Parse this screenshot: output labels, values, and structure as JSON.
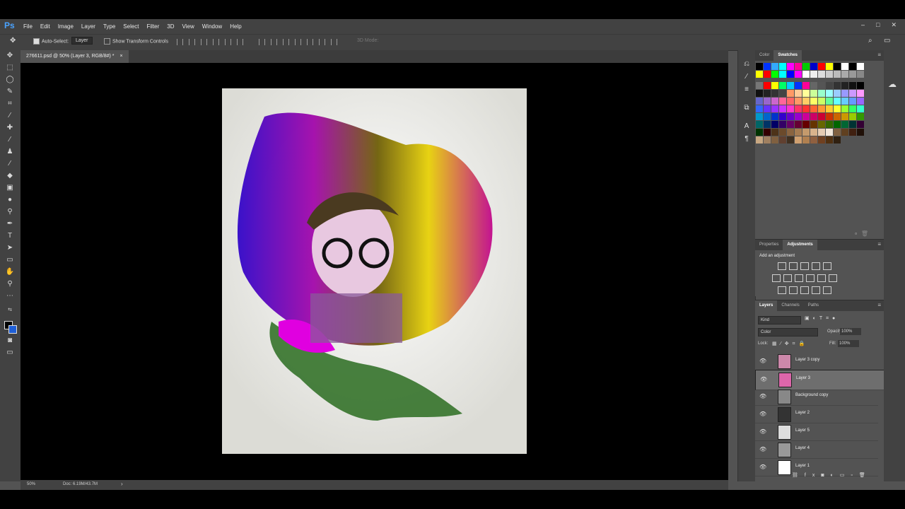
{
  "app": {
    "logo": "Ps"
  },
  "menu": [
    "File",
    "Edit",
    "Image",
    "Layer",
    "Type",
    "Select",
    "Filter",
    "3D",
    "View",
    "Window",
    "Help"
  ],
  "window_controls": [
    "–",
    "□",
    "✕"
  ],
  "options": {
    "auto_select_label": "Auto-Select:",
    "auto_select_value": "Layer",
    "show_transform_label": "Show Transform Controls",
    "mode_3d_label": "3D Mode:"
  },
  "document": {
    "tab_title": "276611.psd @ 50% (Layer 3, RGB/8#) *",
    "close": "×"
  },
  "status": {
    "zoom": "50%",
    "doc": "Doc: 6.19M/43.7M",
    "arrow": "›"
  },
  "panels": {
    "color_tab": "Color",
    "swatches_tab": "Swatches",
    "properties_tab": "Properties",
    "adjustments_tab": "Adjustments",
    "add_adjustment": "Add an adjustment",
    "layers_tab": "Layers",
    "channels_tab": "Channels",
    "paths_tab": "Paths"
  },
  "layers_panel": {
    "kind": "Kind",
    "blend_mode": "Color",
    "opacity_label": "Opacity:",
    "opacity_value": "100%",
    "lock_label": "Lock:",
    "fill_label": "Fill:",
    "fill_value": "100%",
    "layers": [
      {
        "name": "Layer 3 copy",
        "selected": false,
        "thumb": "#c8a"
      },
      {
        "name": "Layer 3",
        "selected": true,
        "thumb": "#d6a"
      },
      {
        "name": "Background copy",
        "selected": false,
        "thumb": "#888"
      },
      {
        "name": "Layer 2",
        "selected": false,
        "thumb": "#333"
      },
      {
        "name": "Layer 5",
        "selected": false,
        "thumb": "#ddd"
      },
      {
        "name": "Layer 4",
        "selected": false,
        "thumb": "#999"
      },
      {
        "name": "Layer 1",
        "selected": false,
        "thumb": "#fff"
      }
    ]
  },
  "colors": {
    "swatch_rows": [
      [
        "#000000",
        "#0033ff",
        "#33aaff",
        "#00ffff",
        "#ff00ff",
        "#ff0099",
        "#00cc00",
        "#0000cc",
        "#ff0000",
        "#ffff00",
        "#000000",
        "#ffffff",
        "#000000",
        "#ffffff"
      ],
      [
        "#ffff00",
        "#ff0000",
        "#00ff00",
        "#00ffff",
        "#0000ff",
        "#ff00ff",
        "#ffffff",
        "#eeeeee",
        "#dddddd",
        "#cccccc",
        "#bbbbbb",
        "#aaaaaa",
        "#999999",
        "#888888"
      ],
      [
        "#777777",
        "#ff0000",
        "#ffff00",
        "#00ff66",
        "#00ccff",
        "#0033ff",
        "#ff0099",
        "#666666",
        "#555555",
        "#444444",
        "#333333",
        "#222222",
        "#111111",
        "#000000"
      ],
      [
        "#111111",
        "#222222",
        "#333333",
        "#444444",
        "#ff9966",
        "#ffcc99",
        "#ffff99",
        "#ccff99",
        "#99ffcc",
        "#99ffff",
        "#99ccff",
        "#9999ff",
        "#cc99ff",
        "#ff99ff"
      ],
      [
        "#6666cc",
        "#9966cc",
        "#cc66cc",
        "#ff6699",
        "#ff6666",
        "#ff9966",
        "#ffcc66",
        "#ffff66",
        "#ccff66",
        "#66ff99",
        "#66ffff",
        "#66ccff",
        "#6699ff",
        "#9966ff"
      ],
      [
        "#3366ff",
        "#6633ff",
        "#9933ff",
        "#cc33ff",
        "#ff33cc",
        "#ff3366",
        "#ff3333",
        "#ff6633",
        "#ff9933",
        "#ffcc33",
        "#ffff33",
        "#99ff33",
        "#33ff66",
        "#33ffcc"
      ],
      [
        "#0099cc",
        "#0066cc",
        "#0033cc",
        "#3300cc",
        "#6600cc",
        "#9900cc",
        "#cc0099",
        "#cc0066",
        "#cc0033",
        "#cc3300",
        "#cc6600",
        "#cc9900",
        "#99cc00",
        "#339900"
      ],
      [
        "#006666",
        "#003366",
        "#000066",
        "#330066",
        "#660066",
        "#660033",
        "#660000",
        "#663300",
        "#666600",
        "#336600",
        "#006600",
        "#006633",
        "#003333",
        "#330033"
      ],
      [
        "#003300",
        "#330000",
        "#4d3319",
        "#6b4a2b",
        "#8a6440",
        "#a67c52",
        "#c49a6c",
        "#d9b38c",
        "#e6ccb3",
        "#f2e6d9",
        "#806040",
        "#604020",
        "#402010",
        "#201008"
      ],
      [
        "#c8a882",
        "#a08060",
        "#806040",
        "#604030",
        "#403020",
        "#d0a070",
        "#b08050",
        "#906040",
        "#704020",
        "#503010",
        "#302010"
      ]
    ]
  }
}
